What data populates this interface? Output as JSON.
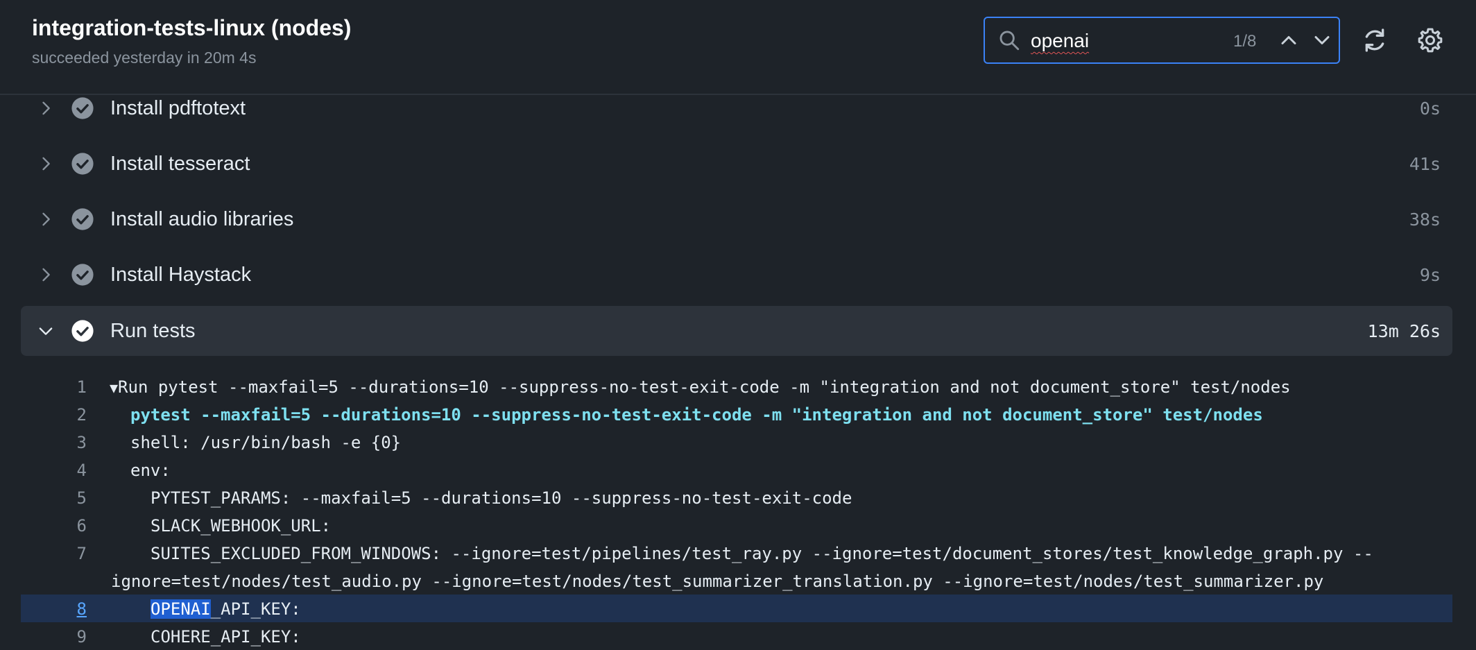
{
  "job": {
    "title": "integration-tests-linux (nodes)",
    "status": "succeeded yesterday in 20m 4s"
  },
  "search": {
    "value": "openai",
    "match_count": "1/8"
  },
  "steps": [
    {
      "name": "Install pdftotext",
      "duration": "0s"
    },
    {
      "name": "Install tesseract",
      "duration": "41s"
    },
    {
      "name": "Install audio libraries",
      "duration": "38s"
    },
    {
      "name": "Install Haystack",
      "duration": "9s"
    },
    {
      "name": "Run tests",
      "duration": "13m 26s"
    }
  ],
  "log": {
    "caret": "▼",
    "lines": [
      {
        "num": "1",
        "text": "Run pytest --maxfail=5 --durations=10 --suppress-no-test-exit-code -m \"integration and not document_store\" test/nodes"
      },
      {
        "num": "2",
        "text": "pytest --maxfail=5 --durations=10 --suppress-no-test-exit-code -m \"integration and not document_store\" test/nodes"
      },
      {
        "num": "3",
        "text": "shell: /usr/bin/bash -e {0}"
      },
      {
        "num": "4",
        "text": "env:"
      },
      {
        "num": "5",
        "text": "PYTEST_PARAMS: --maxfail=5 --durations=10 --suppress-no-test-exit-code"
      },
      {
        "num": "6",
        "text": "SLACK_WEBHOOK_URL:"
      },
      {
        "num": "7",
        "text": "SUITES_EXCLUDED_FROM_WINDOWS: --ignore=test/pipelines/test_ray.py --ignore=test/document_stores/test_knowledge_graph.py --",
        "continuation": "ignore=test/nodes/test_audio.py --ignore=test/nodes/test_summarizer_translation.py --ignore=test/nodes/test_summarizer.py"
      },
      {
        "num": "8",
        "match": "OPENAI",
        "rest": "_API_KEY:"
      },
      {
        "num": "9",
        "text": "COHERE_API_KEY:"
      }
    ]
  }
}
